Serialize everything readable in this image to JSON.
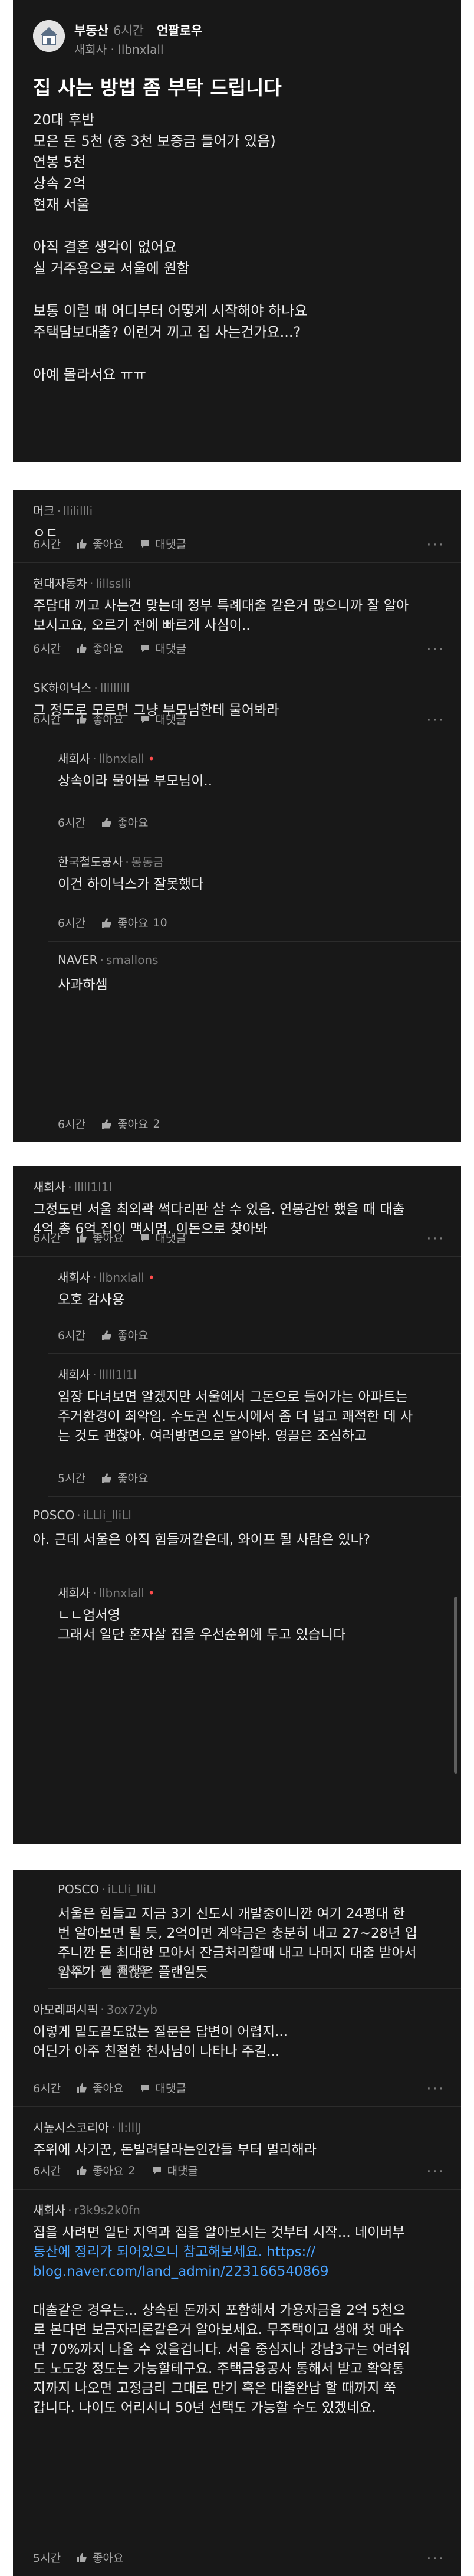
{
  "post": {
    "board": "부동산",
    "time": "6시간",
    "follow_label": "언팔로우",
    "company": "새회사",
    "nickname": "llbnxlall",
    "title": "집 사는 방법 좀 부탁 드립니다",
    "body": [
      "20대 후반",
      "모은 돈 5천 (중 3천 보증금 들어가 있음)",
      "연봉 5천",
      "상속 2억",
      "현재 서울",
      "",
      "아직 결혼 생각이 없어요",
      "실 거주용으로 서울에 원함",
      "",
      "보통 이럴 때 어디부터 어떻게 시작해야 하나요",
      "주택담보대출? 이런거 끼고 집 사는건가요...?",
      "",
      "아예 몰라서요 ㅠㅠ"
    ]
  },
  "labels": {
    "like": "좋아요",
    "reply": "대댓글",
    "more": "···"
  },
  "cards": [
    {
      "comments": [
        {
          "company": "머크",
          "nickname": "llilillli",
          "text": [
            "ㅇㄷ"
          ],
          "time": "6시간",
          "likes": "",
          "reply_btn": true
        },
        {
          "company": "현대자동차",
          "nickname": "lillsslli",
          "text": [
            "주담대 끼고 사는건 맞는데 정부 특례대출 같은거 많으니까 잘 알아",
            "보시고요, 오르기 전에 빠르게 사심이.."
          ],
          "time": "6시간",
          "likes": "",
          "reply_btn": true
        },
        {
          "company": "SK하이닉스",
          "nickname": "lllllllll",
          "text": [
            "그 정도로 모르면 그냥 부모님한테 물어봐라"
          ],
          "time": "6시간",
          "likes": "",
          "reply_btn": true
        },
        {
          "company": "새회사",
          "nickname": "llbnxlall",
          "op": true,
          "reply": true,
          "text": [
            "상속이라 물어볼 부모님이.."
          ],
          "time": "6시간",
          "likes": "",
          "reply_btn": false
        },
        {
          "company": "한국철도공사",
          "nickname": "몽동금",
          "reply": true,
          "text": [
            "이건 하이닉스가 잘못했다"
          ],
          "time": "6시간",
          "likes": "10",
          "reply_btn": false
        },
        {
          "company": "NAVER",
          "nickname": "smallons",
          "reply": true,
          "text": [
            "사과하셈"
          ],
          "time": "6시간",
          "likes": "2",
          "reply_btn": false
        }
      ]
    },
    {
      "comments": [
        {
          "company": "새회사",
          "nickname": "lllll1l1l",
          "text": [
            "그정도면 서울 최외곽 썩다리판 살 수 있음. 연봉감안 했을 때 대출",
            "4억 총 6억 집이 맥시멈. 이돈으로 찾아봐"
          ],
          "time": "6시간",
          "likes": "",
          "reply_btn": true
        },
        {
          "company": "새회사",
          "nickname": "llbnxlall",
          "op": true,
          "reply": true,
          "text": [
            "오호 감사용"
          ],
          "time": "6시간",
          "likes": "",
          "reply_btn": false
        },
        {
          "company": "새회사",
          "nickname": "lllll1l1l",
          "reply": true,
          "text": [
            "임장 다녀보면 알겠지만 서울에서 그돈으로 들어가는 아파트는",
            "주거환경이 최악임. 수도권 신도시에서 좀 더 넓고 쾌적한 데 사",
            "는 것도 괜찮아. 여러방면으로 알아봐. 영끌은 조심하고"
          ],
          "time": "5시간",
          "likes": "",
          "reply_btn": false
        },
        {
          "company": "POSCO",
          "nickname": "iLLli_lliLl",
          "text": [
            "아. 근데 서울은 아직 힘들꺼같은데, 와이프 될 사람은 있나?"
          ],
          "time": "",
          "likes": "",
          "reply_btn": false
        },
        {
          "company": "새회사",
          "nickname": "llbnxlall",
          "op": true,
          "reply": true,
          "text": [
            "ㄴㄴ엄서영",
            "그래서 일단 혼자살 집을 우선순위에 두고 있습니다"
          ],
          "time": "",
          "likes": "",
          "reply_btn": false
        }
      ]
    },
    {
      "comments": [
        {
          "company": "POSCO",
          "nickname": "iLLli_lliLl",
          "reply": true,
          "text": [
            "서울은 힘들고 지금 3기 신도시 개발중이니깐 여기 24평대 한",
            "번 알아보면 될 듯, 2억이면 계약금은 충분히 내고 27~28년 입",
            "주니깐 돈 최대한 모아서 잔금처리할때 내고 나머지 대출 받아서",
            "입주가 젤 괜찮은 플랜일듯"
          ],
          "time": "5시간",
          "likes": "",
          "reply_btn": false
        },
        {
          "company": "아모레퍼시픽",
          "nickname": "3ox72yb",
          "text": [
            "이렇게 밑도끝도없는 질문은 답변이 어렵지...",
            "어딘가 아주 친절한 천사님이 나타나 주길..."
          ],
          "time": "6시간",
          "likes": "",
          "reply_btn": true
        },
        {
          "company": "시높시스코리아",
          "nickname": "ll:lllJ",
          "text": [
            "주위에 사기꾼, 돈빌려달라는인간들 부터 멀리해라"
          ],
          "time": "6시간",
          "likes": "2",
          "reply_btn": true
        },
        {
          "company": "새회사",
          "nickname": "r3k9s2k0fn",
          "text": [
            "집을 사려면 일단 지역과 집을 알아보시는 것부터 시작... 네이버부",
            "동산에 정리가 되어있으니 참고해보세요. https://",
            "blog.naver.com/land_admin/223166540869",
            "",
            "대출같은 경우는... 상속된 돈까지 포함해서 가용자금을 2억 5천으",
            "로 본다면 보금자리론같은거 알아보세요. 무주택이고 생애 첫 매수",
            "면 70%까지 나올 수 있을겁니다. 서울 중심지나 강남3구는 어려워",
            "도 노도강 정도는 가능할테구요. 주택금융공사 통해서 받고 확약통",
            "지까지 나오면 고정금리 그대로 만기 혹은 대출완납 할 때까지 쭉",
            "갑니다. 나이도 어리시니 50년 선택도 가능할 수도 있겠네요."
          ],
          "link_lines": [
            1,
            2
          ],
          "time": "5시간",
          "likes": "",
          "reply_btn": false
        }
      ]
    }
  ]
}
